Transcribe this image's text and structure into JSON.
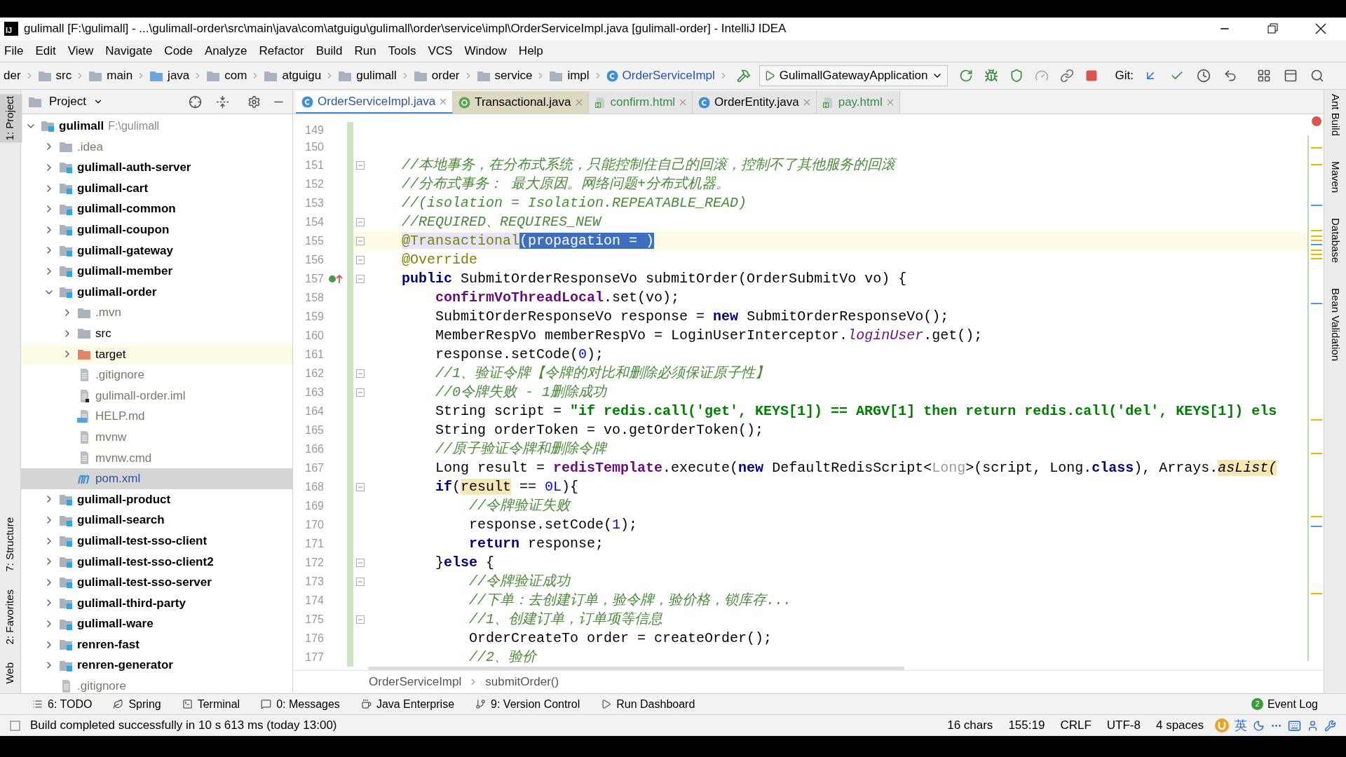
{
  "window": {
    "title": "gulimall [F:\\gulimall] - ...\\gulimall-order\\src\\main\\java\\com\\atguigu\\gulimall\\order\\service\\impl\\OrderServiceImpl.java [gulimall-order] - IntelliJ IDEA",
    "logo": "IJ"
  },
  "menu": [
    "File",
    "Edit",
    "View",
    "Navigate",
    "Code",
    "Analyze",
    "Refactor",
    "Build",
    "Run",
    "Tools",
    "VCS",
    "Window",
    "Help"
  ],
  "navbar": {
    "crumbs": [
      {
        "label": "der",
        "kind": "plain"
      },
      {
        "label": "src",
        "kind": "folder"
      },
      {
        "label": "main",
        "kind": "folder"
      },
      {
        "label": "java",
        "kind": "source"
      },
      {
        "label": "com",
        "kind": "folder"
      },
      {
        "label": "atguigu",
        "kind": "folder"
      },
      {
        "label": "gulimall",
        "kind": "folder"
      },
      {
        "label": "order",
        "kind": "folder"
      },
      {
        "label": "service",
        "kind": "folder"
      },
      {
        "label": "impl",
        "kind": "folder"
      },
      {
        "label": "OrderServiceImpl",
        "kind": "class"
      }
    ],
    "run_config": "GulimallGatewayApplication",
    "git_label": "Git:"
  },
  "left_strip": [
    {
      "label": "1: Project",
      "selected": true
    },
    {
      "label": "7: Structure",
      "selected": false
    },
    {
      "label": "2: Favorites",
      "selected": false
    },
    {
      "label": "Web",
      "selected": false
    }
  ],
  "right_strip": [
    "Ant Build",
    "Maven",
    "Database",
    "Bean Validation"
  ],
  "project": {
    "header": "Project",
    "tree": {
      "name": "gulimall",
      "path": "F:\\gulimall",
      "kind": "module",
      "color": "#000000",
      "expanded": true,
      "selected": false,
      "children": [
        {
          "name": ".idea",
          "kind": "folder",
          "color": "#7a7a6a",
          "expanded": false,
          "selected": false
        },
        {
          "name": "gulimall-auth-server",
          "kind": "module",
          "color": "#000000",
          "expanded": false,
          "selected": false
        },
        {
          "name": "gulimall-cart",
          "kind": "module",
          "color": "#000000",
          "expanded": false,
          "selected": false
        },
        {
          "name": "gulimall-common",
          "kind": "module",
          "color": "#000000",
          "expanded": false,
          "selected": false
        },
        {
          "name": "gulimall-coupon",
          "kind": "module",
          "color": "#000000",
          "expanded": false,
          "selected": false
        },
        {
          "name": "gulimall-gateway",
          "kind": "module",
          "color": "#000000",
          "expanded": false,
          "selected": false
        },
        {
          "name": "gulimall-member",
          "kind": "module",
          "color": "#000000",
          "expanded": false,
          "selected": false
        },
        {
          "name": "gulimall-order",
          "kind": "module",
          "color": "#000000",
          "expanded": true,
          "selected": false,
          "children": [
            {
              "name": ".mvn",
              "kind": "folder",
              "color": "#7a7a6a",
              "expanded": false,
              "selected": false
            },
            {
              "name": "src",
              "kind": "folder",
              "color": "#000000",
              "expanded": false,
              "selected": false
            },
            {
              "name": "target",
              "kind": "excluded",
              "color": "#000000",
              "expanded": false,
              "selected": false
            },
            {
              "name": ".gitignore",
              "kind": "file",
              "color": "#7a7a6a",
              "selected": false
            },
            {
              "name": "gulimall-order.iml",
              "kind": "iml",
              "color": "#7a7a6a",
              "selected": false
            },
            {
              "name": "HELP.md",
              "kind": "markdown",
              "color": "#7a7a6a",
              "selected": false
            },
            {
              "name": "mvnw",
              "kind": "file",
              "color": "#7a7a6a",
              "selected": false
            },
            {
              "name": "mvnw.cmd",
              "kind": "file",
              "color": "#7a7a6a",
              "selected": false
            },
            {
              "name": "pom.xml",
              "kind": "maven",
              "color": "#2a55a6",
              "selected": true
            }
          ]
        },
        {
          "name": "gulimall-product",
          "kind": "module",
          "color": "#000000",
          "expanded": false,
          "selected": false
        },
        {
          "name": "gulimall-search",
          "kind": "module",
          "color": "#000000",
          "expanded": false,
          "selected": false
        },
        {
          "name": "gulimall-test-sso-client",
          "kind": "module",
          "color": "#000000",
          "expanded": false,
          "selected": false
        },
        {
          "name": "gulimall-test-sso-client2",
          "kind": "module",
          "color": "#000000",
          "expanded": false,
          "selected": false
        },
        {
          "name": "gulimall-test-sso-server",
          "kind": "module",
          "color": "#000000",
          "expanded": false,
          "selected": false
        },
        {
          "name": "gulimall-third-party",
          "kind": "module",
          "color": "#000000",
          "expanded": false,
          "selected": false
        },
        {
          "name": "gulimall-ware",
          "kind": "module",
          "color": "#000000",
          "expanded": false,
          "selected": false
        },
        {
          "name": "renren-fast",
          "kind": "module",
          "color": "#000000",
          "expanded": false,
          "selected": false
        },
        {
          "name": "renren-generator",
          "kind": "module",
          "color": "#000000",
          "expanded": false,
          "selected": false
        },
        {
          "name": ".gitignore",
          "kind": "file",
          "color": "#7a7a6a",
          "selected": false
        }
      ]
    }
  },
  "editor": {
    "tabs": [
      {
        "label": "OrderServiceImpl.java",
        "kind": "class",
        "color": "#2a55a6",
        "library": false,
        "selected": true
      },
      {
        "label": "Transactional.java",
        "kind": "annotation",
        "color": "#000000",
        "library": true,
        "selected": false
      },
      {
        "label": "confirm.html",
        "kind": "html",
        "color": "#3b8a4a",
        "library": false,
        "selected": false
      },
      {
        "label": "OrderEntity.java",
        "kind": "class",
        "color": "#000000",
        "library": false,
        "selected": false
      },
      {
        "label": "pay.html",
        "kind": "html",
        "color": "#3b8a4a",
        "library": false,
        "selected": false
      }
    ],
    "lines": [
      {
        "n": "149"
      },
      {
        "n": "150"
      },
      {
        "n": "151",
        "fold": true,
        "current": false,
        "spans": [
          {
            "kind": "comment",
            "text": "    //本地事务，在分布式系统，只能控制住自己的回滚，控制不了其他服务的回滚"
          }
        ]
      },
      {
        "n": "152",
        "fold": false,
        "current": false,
        "spans": [
          {
            "kind": "comment",
            "text": "    //分布式事务： 最大原因。网络问题+分布式机器。"
          }
        ]
      },
      {
        "n": "153",
        "fold": false,
        "current": false,
        "spans": [
          {
            "kind": "comment",
            "text": "    //(isolation = Isolation.REPEATABLE_READ)"
          }
        ]
      },
      {
        "n": "154",
        "fold": true,
        "current": false,
        "spans": [
          {
            "kind": "comment",
            "text": "    //REQUIRED、REQUIRES_NEW"
          }
        ]
      },
      {
        "n": "155",
        "fold": true,
        "current": true,
        "spans": [
          {
            "kind": "annotation_usage",
            "text": "    @Transactional"
          },
          {
            "kind": "selection",
            "text": "(propagation = )"
          }
        ]
      },
      {
        "n": "156",
        "fold": true,
        "current": false,
        "spans": [
          {
            "kind": "annotation",
            "text": "    @Override"
          }
        ]
      },
      {
        "n": "157",
        "fold": true,
        "current": false,
        "override": true,
        "spans": [
          {
            "kind": "keyword",
            "text": "    public"
          },
          {
            "kind": "plain",
            "text": " SubmitOrderResponseVo submitOrder(OrderSubmitVo vo) {"
          }
        ]
      },
      {
        "n": "158",
        "fold": false,
        "current": false,
        "spans": [
          {
            "kind": "field",
            "text": "        confirmVoThreadLocal"
          },
          {
            "kind": "plain",
            "text": ".set(vo);"
          }
        ]
      },
      {
        "n": "159",
        "fold": false,
        "current": false,
        "spans": [
          {
            "kind": "plain",
            "text": "        SubmitOrderResponseVo response = "
          },
          {
            "kind": "keyword",
            "text": "new"
          },
          {
            "kind": "plain",
            "text": " SubmitOrderResponseVo();"
          }
        ]
      },
      {
        "n": "160",
        "fold": false,
        "current": false,
        "spans": [
          {
            "kind": "plain",
            "text": "        MemberRespVo memberRespVo = LoginUserInterceptor."
          },
          {
            "kind": "static_field",
            "text": "loginUser"
          },
          {
            "kind": "plain",
            "text": ".get();"
          }
        ]
      },
      {
        "n": "161",
        "fold": false,
        "current": false,
        "spans": [
          {
            "kind": "plain",
            "text": "        response.setCode("
          },
          {
            "kind": "number",
            "text": "0"
          },
          {
            "kind": "plain",
            "text": ");"
          }
        ]
      },
      {
        "n": "162",
        "fold": true,
        "current": false,
        "spans": [
          {
            "kind": "comment",
            "text": "        //1、验证令牌【令牌的对比和删除必须保证原子性】"
          }
        ]
      },
      {
        "n": "163",
        "fold": true,
        "current": false,
        "spans": [
          {
            "kind": "comment",
            "text": "        //0令牌失败 - 1删除成功"
          }
        ]
      },
      {
        "n": "164",
        "fold": false,
        "current": false,
        "spans": [
          {
            "kind": "plain",
            "text": "        String script = "
          },
          {
            "kind": "string",
            "text": "\"if redis.call('get', KEYS[1]) == ARGV[1] then return redis.call('del', KEYS[1]) els"
          }
        ]
      },
      {
        "n": "165",
        "fold": false,
        "current": false,
        "spans": [
          {
            "kind": "plain",
            "text": "        String orderToken = vo.getOrderToken();"
          }
        ]
      },
      {
        "n": "166",
        "fold": false,
        "current": false,
        "spans": [
          {
            "kind": "comment",
            "text": "        //原子验证令牌和删除令牌"
          }
        ]
      },
      {
        "n": "167",
        "fold": false,
        "current": false,
        "spans": [
          {
            "kind": "plain",
            "text": "        Long result = "
          },
          {
            "kind": "field",
            "text": "redisTemplate"
          },
          {
            "kind": "plain",
            "text": ".execute("
          },
          {
            "kind": "keyword",
            "text": "new"
          },
          {
            "kind": "plain",
            "text": " DefaultRedisScript<"
          },
          {
            "kind": "generic",
            "text": "Long"
          },
          {
            "kind": "plain",
            "text": ">(script, Long."
          },
          {
            "kind": "keyword",
            "text": "class"
          },
          {
            "kind": "plain",
            "text": "), Arrays."
          },
          {
            "kind": "static_usage",
            "text": "asList("
          }
        ]
      },
      {
        "n": "168",
        "fold": true,
        "current": false,
        "spans": [
          {
            "kind": "keyword",
            "text": "        if"
          },
          {
            "kind": "plain",
            "text": "("
          },
          {
            "kind": "usage",
            "text": "result"
          },
          {
            "kind": "plain",
            "text": " == "
          },
          {
            "kind": "number",
            "text": "0L"
          },
          {
            "kind": "plain",
            "text": "){"
          }
        ]
      },
      {
        "n": "169",
        "fold": false,
        "current": false,
        "spans": [
          {
            "kind": "comment",
            "text": "            //令牌验证失败"
          }
        ]
      },
      {
        "n": "170",
        "fold": false,
        "current": false,
        "spans": [
          {
            "kind": "plain",
            "text": "            response.setCode("
          },
          {
            "kind": "number",
            "text": "1"
          },
          {
            "kind": "plain",
            "text": ");"
          }
        ]
      },
      {
        "n": "171",
        "fold": false,
        "current": false,
        "spans": [
          {
            "kind": "keyword",
            "text": "            return"
          },
          {
            "kind": "plain",
            "text": " response;"
          }
        ]
      },
      {
        "n": "172",
        "fold": true,
        "current": false,
        "spans": [
          {
            "kind": "plain",
            "text": "        }"
          },
          {
            "kind": "keyword",
            "text": "else"
          },
          {
            "kind": "plain",
            "text": " {"
          }
        ]
      },
      {
        "n": "173",
        "fold": true,
        "current": false,
        "spans": [
          {
            "kind": "comment",
            "text": "            //令牌验证成功"
          }
        ]
      },
      {
        "n": "174",
        "fold": false,
        "current": false,
        "spans": [
          {
            "kind": "comment",
            "text": "            //下单：去创建订单，验令牌，验价格，锁库存..."
          }
        ]
      },
      {
        "n": "175",
        "fold": true,
        "current": false,
        "spans": [
          {
            "kind": "comment",
            "text": "            //1、创建订单，订单项等信息"
          }
        ]
      },
      {
        "n": "176",
        "fold": false,
        "current": false,
        "spans": [
          {
            "kind": "plain",
            "text": "            OrderCreateTo order = createOrder();"
          }
        ]
      },
      {
        "n": "177",
        "fold": false,
        "current": false,
        "spans": [
          {
            "kind": "comment",
            "text": "            //2、验价"
          }
        ]
      }
    ],
    "breadcrumb": [
      "OrderServiceImpl",
      "submitOrder()"
    ]
  },
  "tool_bar": {
    "items": [
      {
        "label": "6: TODO",
        "kind": "list"
      },
      {
        "label": "Spring",
        "kind": "leaf"
      },
      {
        "label": "Terminal",
        "kind": "terminal"
      },
      {
        "label": "0: Messages",
        "kind": "messages"
      },
      {
        "label": "Java Enterprise",
        "kind": "enterprise"
      },
      {
        "label": "9: Version Control",
        "kind": "vcs"
      },
      {
        "label": "Run Dashboard",
        "kind": "run"
      }
    ],
    "event_log": {
      "label": "Event Log",
      "count": "2"
    }
  },
  "status_bar": {
    "message": "Build completed successfully in 10 s 613 ms (today 13:00)",
    "items": [
      "16 chars",
      "155:19",
      "CRLF",
      "UTF-8",
      "4 spaces"
    ],
    "ime_label": "英"
  }
}
